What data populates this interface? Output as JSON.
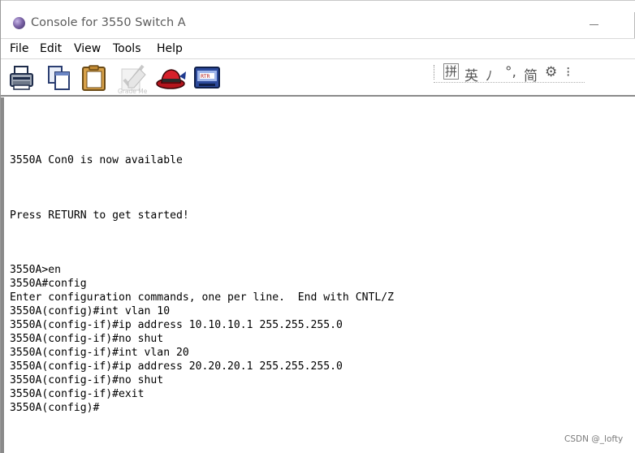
{
  "window": {
    "title": "Console for 3550 Switch A",
    "minimize_glyph": ""
  },
  "menu": {
    "items": [
      "File",
      "Edit",
      "View",
      "Tools",
      "Help"
    ]
  },
  "toolbar": {
    "buttons": [
      {
        "icon": "printer-icon"
      },
      {
        "icon": "copy-icon"
      },
      {
        "icon": "paste-icon"
      },
      {
        "icon": "grade-me-icon",
        "label": "Grade Me"
      },
      {
        "icon": "red-hat-icon"
      },
      {
        "icon": "rtr-icon",
        "label": "RTR"
      }
    ],
    "ime": [
      "拼",
      "英",
      "ﾉ",
      "°,",
      "简",
      "⚙",
      "⁝"
    ]
  },
  "terminal": {
    "lines": [
      "3550A Con0 is now available",
      "Press RETURN to get started!",
      "3550A>en",
      "3550A#config",
      "Enter configuration commands, one per line.  End with CNTL/Z",
      "3550A(config)#int vlan 10",
      "3550A(config-if)#ip address 10.10.10.1 255.255.255.0",
      "3550A(config-if)#no shut",
      "3550A(config-if)#int vlan 20",
      "3550A(config-if)#ip address 20.20.20.1 255.255.255.0",
      "3550A(config-if)#no shut",
      "3550A(config-if)#exit",
      "3550A(config)#"
    ]
  },
  "watermark": "CSDN @_lofty",
  "colors": {
    "title_text": "#5c5c5c",
    "terminal_text": "#000000",
    "window_border": "#8a8a8a"
  }
}
